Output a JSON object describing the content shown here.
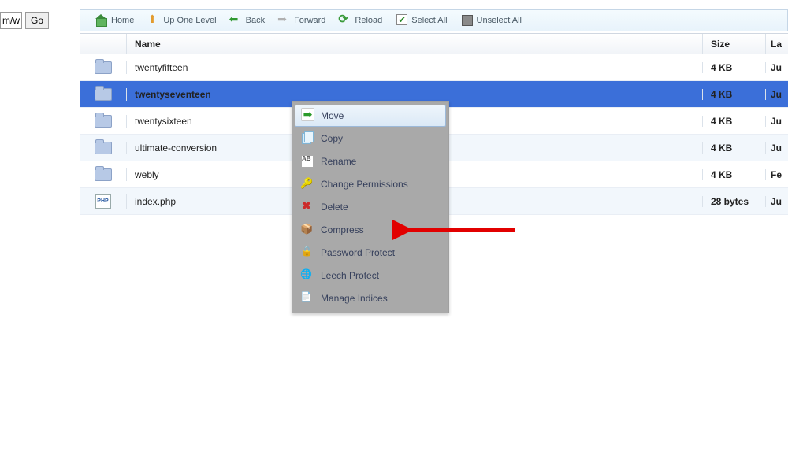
{
  "address": {
    "path_fragment": "m/w",
    "go_label": "Go"
  },
  "toolbar": {
    "home": "Home",
    "up": "Up One Level",
    "back": "Back",
    "forward": "Forward",
    "reload": "Reload",
    "selectall": "Select All",
    "unselect": "Unselect All"
  },
  "columns": {
    "name": "Name",
    "size": "Size",
    "modified": "La"
  },
  "rows": [
    {
      "icon": "folder",
      "name": "twentyfifteen",
      "size": "4 KB",
      "modified": "Ju",
      "selected": false
    },
    {
      "icon": "folder",
      "name": "twentyseventeen",
      "size": "4 KB",
      "modified": "Ju",
      "selected": true
    },
    {
      "icon": "folder",
      "name": "twentysixteen",
      "size": "4 KB",
      "modified": "Ju",
      "selected": false
    },
    {
      "icon": "folder",
      "name": "ultimate-conversion",
      "size": "4 KB",
      "modified": "Ju",
      "selected": false
    },
    {
      "icon": "folder",
      "name": "webly",
      "size": "4 KB",
      "modified": "Fe",
      "selected": false
    },
    {
      "icon": "php",
      "name": "index.php",
      "size": "28 bytes",
      "modified": "Ju",
      "selected": false
    }
  ],
  "context_menu": {
    "items": [
      {
        "id": "move",
        "label": "Move",
        "highlight": true
      },
      {
        "id": "copy",
        "label": "Copy",
        "highlight": false
      },
      {
        "id": "rename",
        "label": "Rename",
        "highlight": false
      },
      {
        "id": "perm",
        "label": "Change Permissions",
        "highlight": false
      },
      {
        "id": "delete",
        "label": "Delete",
        "highlight": false
      },
      {
        "id": "compress",
        "label": "Compress",
        "highlight": false
      },
      {
        "id": "pwprotect",
        "label": "Password Protect",
        "highlight": false
      },
      {
        "id": "leech",
        "label": "Leech Protect",
        "highlight": false
      },
      {
        "id": "indices",
        "label": "Manage Indices",
        "highlight": false
      }
    ]
  },
  "php_icon_label": "PHP"
}
